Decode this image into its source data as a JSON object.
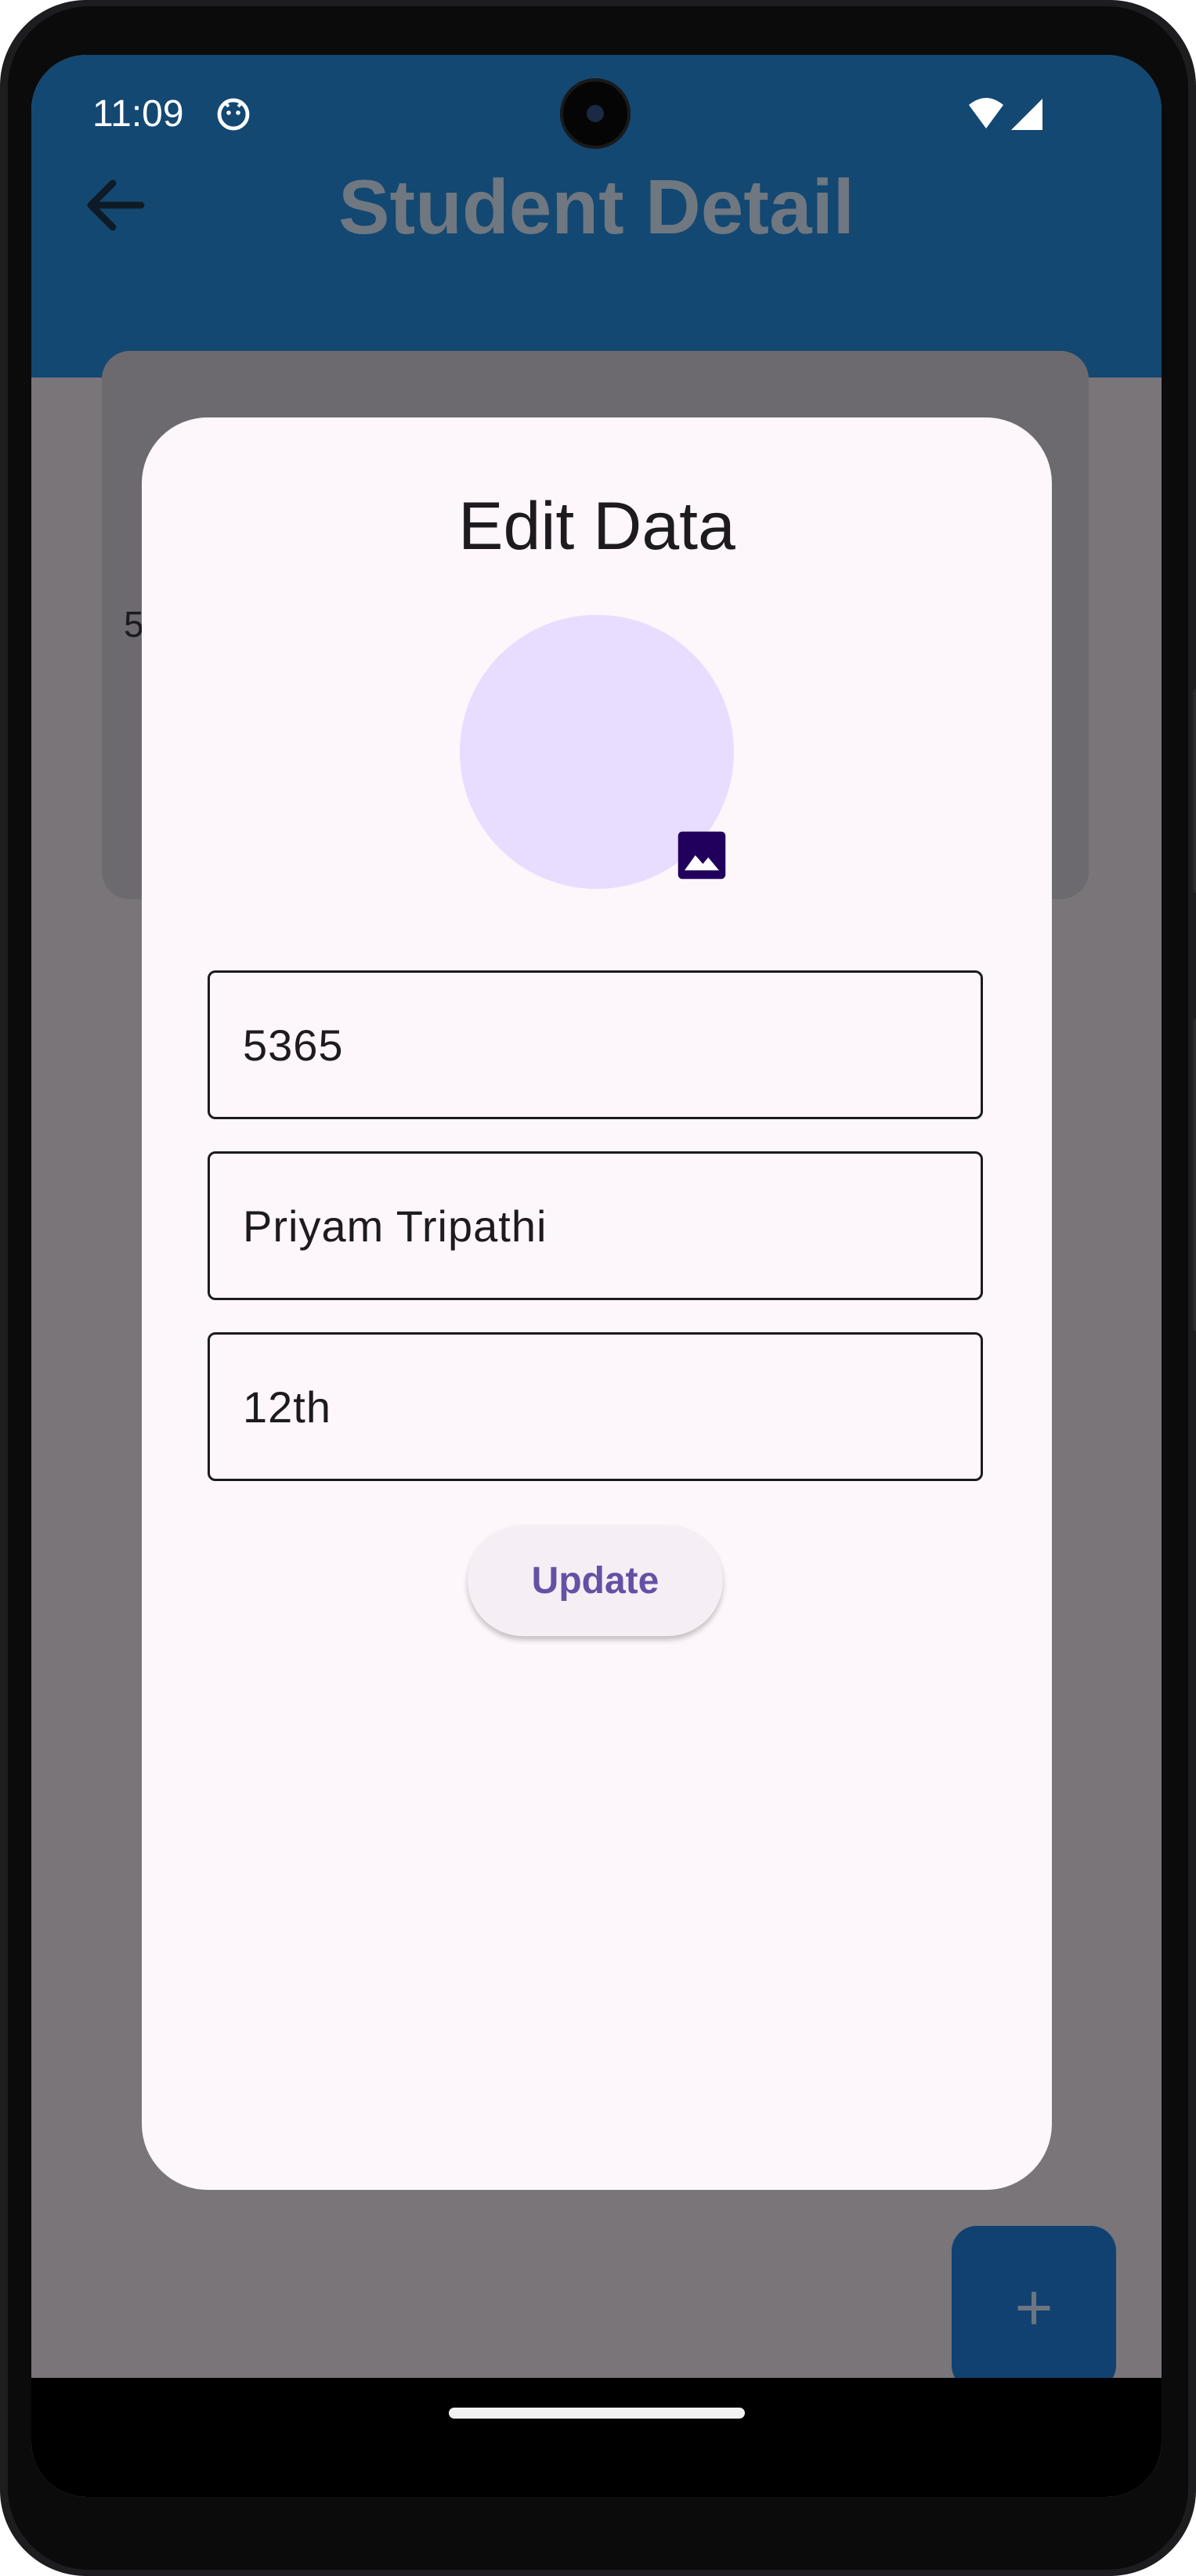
{
  "status_bar": {
    "time": "11:09"
  },
  "app_bar": {
    "title": "Student Detail"
  },
  "background_card": {
    "partial_text": "5"
  },
  "dialog": {
    "title": "Edit Data",
    "fields": {
      "id": "5365",
      "name": "Priyam Tripathi",
      "class": "12th"
    },
    "update_label": "Update"
  },
  "fab": {
    "label": "+"
  },
  "colors": {
    "app_bar": "#134872",
    "scrim_background": "#7a7579",
    "dialog_surface": "#fdf6fb",
    "avatar": "#e9ddff",
    "accent_text": "#6650a4",
    "image_icon": "#21005d"
  },
  "icons": {
    "back": "arrow-left-icon",
    "status": "face-notification-icon",
    "wifi": "wifi-icon",
    "signal": "cell-signal-icon",
    "image_pick": "image-icon",
    "fab": "plus-icon"
  }
}
